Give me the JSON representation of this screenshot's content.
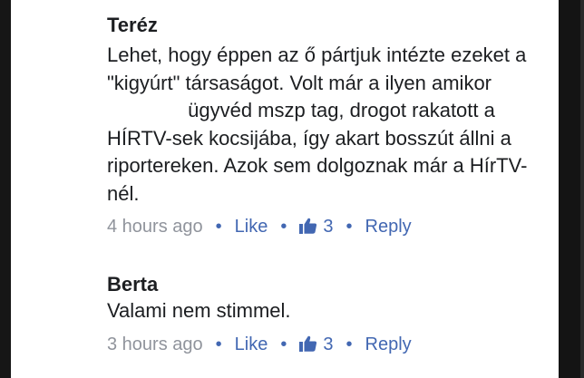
{
  "comments": [
    {
      "author": "Teréz",
      "text_before_redaction": "Lehet, hogy éppen az ő pártjuk intézte ezeket a \"kigyúrt\" társaságot. Volt már a ilyen amikor",
      "text_after_redaction": "ügyvéd mszp tag, drogot rakatott a HÍRTV-sek kocsijába, így akart bosszút állni a riportereken. Azok sem dolgoznak már a HírTV-nél.",
      "timestamp": "4 hours ago",
      "like_label": "Like",
      "like_count": "3",
      "reply_label": "Reply"
    },
    {
      "author": "Berta",
      "text": "Valami nem stimmel.",
      "timestamp": "3 hours ago",
      "like_label": "Like",
      "like_count": "3",
      "reply_label": "Reply"
    }
  ],
  "separator": "•",
  "icons": {
    "like_count_icon": "thumbs-up-icon"
  },
  "colors": {
    "text": "#1c1e21",
    "meta": "#90949c",
    "link": "#4267b2",
    "background": "#ffffff",
    "frame": "#1a1a1a"
  }
}
